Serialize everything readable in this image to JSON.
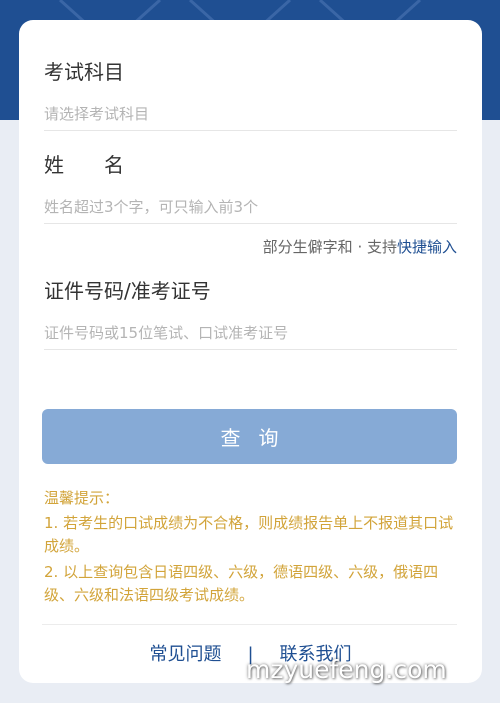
{
  "form": {
    "subject": {
      "label": "考试科目",
      "placeholder": "请选择考试科目"
    },
    "name": {
      "label": "姓　　名",
      "placeholder": "姓名超过3个字，可只输入前3个"
    },
    "name_hint": {
      "text": "部分生僻字和 · 支持",
      "link": "快捷输入"
    },
    "id": {
      "label": "证件号码/准考证号",
      "placeholder": "证件号码或15位笔试、口试准考证号"
    },
    "query_button": "查询"
  },
  "tips": {
    "title": "温馨提示：",
    "items": [
      "1. 若考生的口试成绩为不合格，则成绩报告单上不报道其口试成绩。",
      "2. 以上查询包含日语四级、六级，德语四级、六级，俄语四级、六级和法语四级考试成绩。"
    ]
  },
  "footer": {
    "faq": "常见问题",
    "separator": "|",
    "contact": "联系我们"
  },
  "watermark": "mzyuefeng.com",
  "colors": {
    "brand": "#1f4f92",
    "button": "#86aad6",
    "tips": "#d2a43a"
  }
}
